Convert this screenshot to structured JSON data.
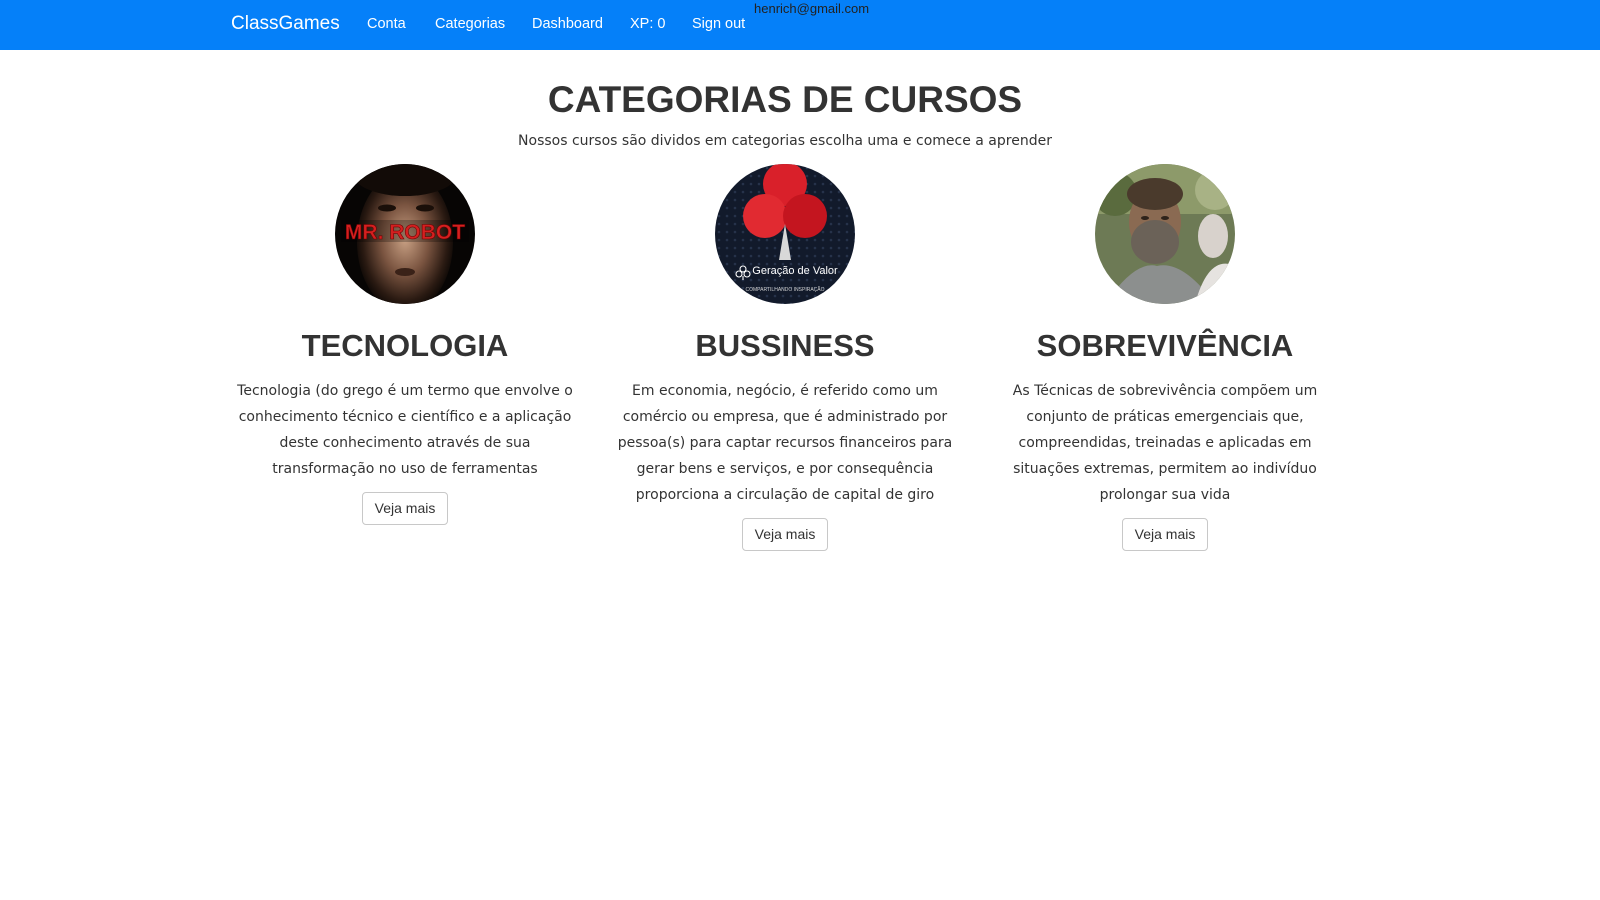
{
  "navbar": {
    "brand": "ClassGames",
    "links": [
      "Conta",
      "Categorias",
      "Dashboard",
      "XP: 0",
      "Sign out"
    ],
    "user_email": "henrich@gmail.com",
    "background": "#0580f9"
  },
  "main": {
    "title": "CATEGORIAS DE CURSOS",
    "subtitle": "Nossos cursos são dividos em categorias escolha uma e comece a aprender",
    "categories": [
      {
        "title": "TECNOLOGIA",
        "image_text": "MR. ROBOT",
        "description": "Tecnologia (do grego é um termo que envolve o conhecimento técnico e científico e a aplicação deste conhecimento através de sua transformação no uso de ferramentas",
        "button": "Veja mais"
      },
      {
        "title": "BUSSINESS",
        "image_text": "Geração de Valor",
        "image_subtext": "COMPARTILHANDO INSPIRAÇÃO",
        "description": "Em economia, negócio, é referido como um comércio ou empresa, que é administrado por pessoa(s) para captar recursos financeiros para gerar bens e serviços, e por consequência proporciona a circulação de capital de giro",
        "button": "Veja mais"
      },
      {
        "title": "SOBREVIVÊNCIA",
        "description": "As Técnicas de sobrevivência compõem um conjunto de práticas emergenciais que, compreendidas, treinadas e aplicadas em situações extremas, permitem ao indivíduo prolongar sua vida",
        "button": "Veja mais"
      }
    ]
  }
}
